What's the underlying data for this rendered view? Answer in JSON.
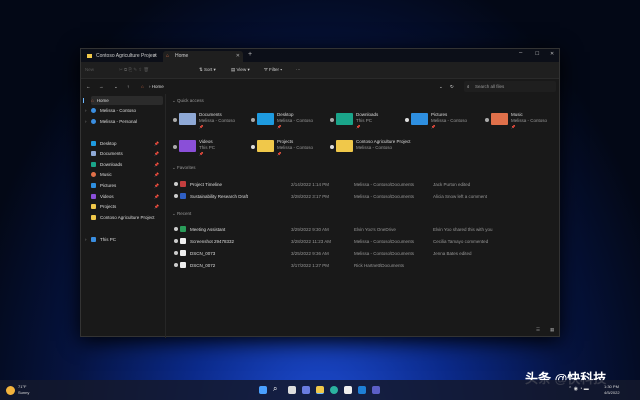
{
  "tabs": [
    {
      "label": "Contoso Agriculture Project"
    },
    {
      "label": "Home"
    }
  ],
  "toolbar": {
    "new": "New",
    "sort": "Sort",
    "view": "View",
    "filter": "Filter",
    "more": "···"
  },
  "address": {
    "path": "Home",
    "search_placeholder": "Search all files"
  },
  "sidebar": {
    "home": "Home",
    "cloud": [
      "Melissa - Contoso",
      "Melissa - Personal"
    ],
    "pinned": [
      "Desktop",
      "Documents",
      "Downloads",
      "Music",
      "Pictures",
      "Videos",
      "Projects",
      "Contoso Agriculture Project"
    ],
    "this_pc": "This PC"
  },
  "quick_access": {
    "title": "Quick access",
    "items": [
      {
        "name": "Documents",
        "sub": "Melissa - Contoso",
        "color": "#8fa9d6"
      },
      {
        "name": "Desktop",
        "sub": "Melissa - Contoso",
        "color": "#1e9be0"
      },
      {
        "name": "Downloads",
        "sub": "This PC",
        "color": "#1aa58a"
      },
      {
        "name": "Pictures",
        "sub": "Melissa - Contoso",
        "color": "#2e8fe0"
      },
      {
        "name": "Music",
        "sub": "Melissa - Contoso",
        "color": "#e0704a"
      },
      {
        "name": "Videos",
        "sub": "This PC",
        "color": "#8a4fd8"
      },
      {
        "name": "Projects",
        "sub": "Melissa - Contoso",
        "color": "#f0c84a"
      },
      {
        "name": "Contoso Agriculture Project",
        "sub": "Melissa - Contoso",
        "color": "#f0c84a"
      }
    ]
  },
  "favorites": {
    "title": "Favorites",
    "rows": [
      {
        "name": "Project Timeline",
        "date": "2/14/2022 1:14 PM",
        "location": "Melissa - Contoso\\Documents",
        "activity": "Jack Purton edited",
        "color": "#c43e3e"
      },
      {
        "name": "Sustainability Research Draft",
        "date": "3/28/2022 3:17 PM",
        "location": "Melissa - Contoso\\Documents",
        "activity": "Alicia Snow left a comment",
        "color": "#2f5fc4"
      }
    ]
  },
  "recent": {
    "title": "Recent",
    "rows": [
      {
        "name": "Meeting Assistant",
        "date": "3/29/2022 9:30 AM",
        "location": "Elvin Yoo's OneDrive",
        "activity": "Elvin Yoo shared this with you",
        "color": "#2a9d5a"
      },
      {
        "name": "Screenshot 29478332",
        "date": "3/28/2022 11:23 AM",
        "location": "Melissa - Contoso\\Documents",
        "activity": "Cecilia Tamayo commented",
        "color": "#eeeeee"
      },
      {
        "name": "DSCN_0073",
        "date": "3/25/2022 9:36 AM",
        "location": "Melissa - Contoso\\Documents",
        "activity": "Jenna Bates edited",
        "color": "#eeeeee"
      },
      {
        "name": "DSCN_0072",
        "date": "3/17/2022 1:27 PM",
        "location": "Rick Hartnett\\Documents",
        "activity": "",
        "color": "#eeeeee"
      }
    ]
  },
  "taskbar": {
    "weather_temp": "71°F",
    "weather_desc": "Sunny",
    "time": "1:30 PM",
    "date": "4/5/2022"
  },
  "watermark": "头条 @快科技"
}
